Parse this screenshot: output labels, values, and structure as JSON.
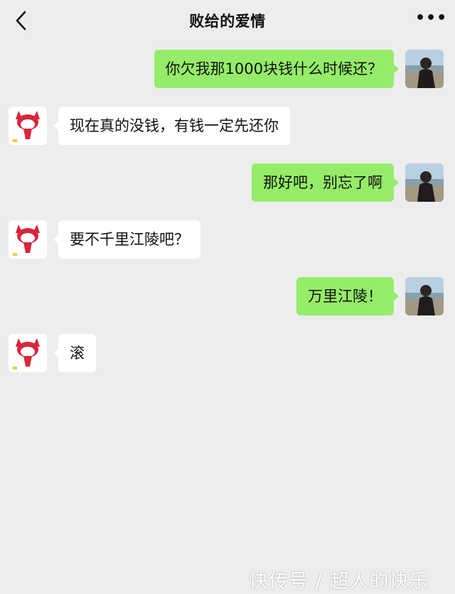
{
  "header": {
    "title": "败给的爱情",
    "back_icon": "chevron-left-icon",
    "more_icon": "more-dots-icon",
    "more_glyph": "•••"
  },
  "messages": [
    {
      "from": "me",
      "text": "你欠我那1000块钱什么时候还？"
    },
    {
      "from": "them",
      "text": "现在真的没钱，有钱一定先还你"
    },
    {
      "from": "me",
      "text": "那好吧，别忘了啊"
    },
    {
      "from": "them",
      "text": "要不千里江陵吧？"
    },
    {
      "from": "me",
      "text": "万里江陵！"
    },
    {
      "from": "them",
      "text": "滚"
    }
  ],
  "colors": {
    "background": "#ededed",
    "my_bubble": "#95ec69",
    "their_bubble": "#ffffff"
  },
  "watermark": "快传号 / 超人的快乐"
}
